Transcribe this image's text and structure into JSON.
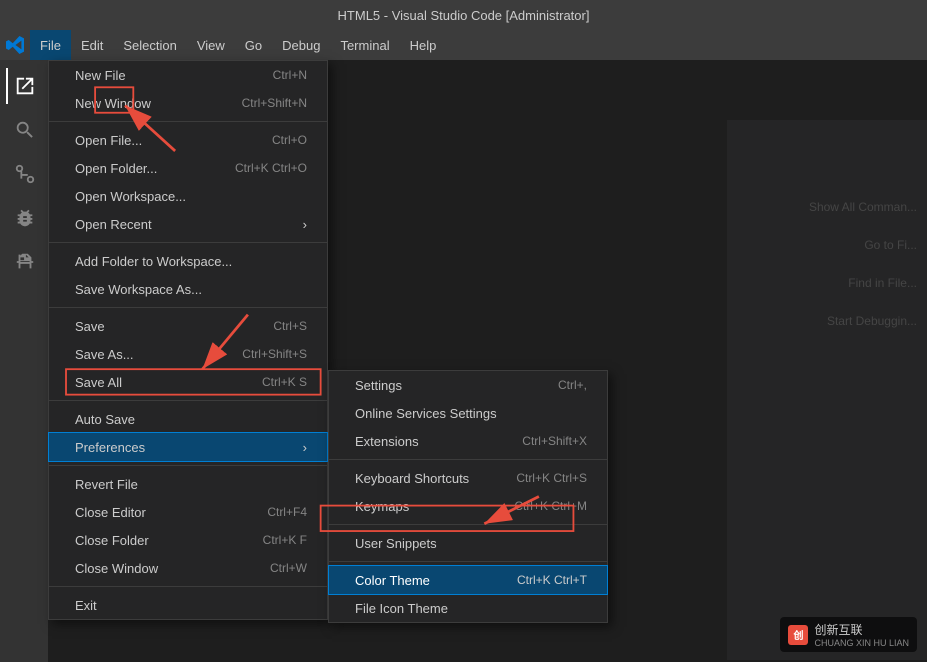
{
  "titleBar": {
    "title": "HTML5 - Visual Studio Code [Administrator]"
  },
  "menuBar": {
    "items": [
      {
        "label": "File",
        "active": true
      },
      {
        "label": "Edit"
      },
      {
        "label": "Selection"
      },
      {
        "label": "View"
      },
      {
        "label": "Go"
      },
      {
        "label": "Debug"
      },
      {
        "label": "Terminal"
      },
      {
        "label": "Help"
      }
    ]
  },
  "fileMenu": {
    "items": [
      {
        "label": "New File",
        "shortcut": "Ctrl+N",
        "separator": false
      },
      {
        "label": "New Window",
        "shortcut": "Ctrl+Shift+N",
        "separator": false
      },
      {
        "label": "",
        "separator": true
      },
      {
        "label": "Open File...",
        "shortcut": "Ctrl+O",
        "separator": false
      },
      {
        "label": "Open Folder...",
        "shortcut": "Ctrl+K Ctrl+O",
        "separator": false
      },
      {
        "label": "Open Workspace...",
        "shortcut": "",
        "separator": false
      },
      {
        "label": "Open Recent",
        "shortcut": "",
        "arrow": true,
        "separator": false
      },
      {
        "label": "",
        "separator": true
      },
      {
        "label": "Add Folder to Workspace...",
        "shortcut": "",
        "separator": false
      },
      {
        "label": "Save Workspace As...",
        "shortcut": "",
        "separator": false
      },
      {
        "label": "",
        "separator": true
      },
      {
        "label": "Save",
        "shortcut": "Ctrl+S",
        "separator": false
      },
      {
        "label": "Save As...",
        "shortcut": "Ctrl+Shift+S",
        "separator": false
      },
      {
        "label": "Save All",
        "shortcut": "Ctrl+K S",
        "separator": false
      },
      {
        "label": "",
        "separator": true
      },
      {
        "label": "Auto Save",
        "shortcut": "",
        "separator": false
      },
      {
        "label": "Preferences",
        "shortcut": "",
        "arrow": true,
        "separator": false,
        "highlighted": true
      },
      {
        "label": "",
        "separator": true
      },
      {
        "label": "Revert File",
        "shortcut": "",
        "separator": false
      },
      {
        "label": "Close Editor",
        "shortcut": "Ctrl+F4",
        "separator": false
      },
      {
        "label": "Close Folder",
        "shortcut": "Ctrl+K F",
        "separator": false
      },
      {
        "label": "Close Window",
        "shortcut": "Ctrl+W",
        "separator": false
      },
      {
        "label": "",
        "separator": true
      },
      {
        "label": "Exit",
        "shortcut": "",
        "separator": false
      }
    ]
  },
  "preferencesMenu": {
    "items": [
      {
        "label": "Settings",
        "shortcut": "Ctrl+,",
        "separator": false
      },
      {
        "label": "Online Services Settings",
        "shortcut": "",
        "separator": false
      },
      {
        "label": "Extensions",
        "shortcut": "Ctrl+Shift+X",
        "separator": false
      },
      {
        "label": "",
        "separator": true
      },
      {
        "label": "Keyboard Shortcuts",
        "shortcut": "Ctrl+K Ctrl+S",
        "separator": false
      },
      {
        "label": "Keymaps",
        "shortcut": "Ctrl+K Ctrl+M",
        "separator": false
      },
      {
        "label": "",
        "separator": true
      },
      {
        "label": "User Snippets",
        "shortcut": "",
        "separator": false
      },
      {
        "label": "",
        "separator": true
      },
      {
        "label": "Color Theme",
        "shortcut": "Ctrl+K Ctrl+T",
        "highlighted": true,
        "separator": false
      },
      {
        "label": "File Icon Theme",
        "shortcut": "",
        "separator": false
      }
    ]
  },
  "rightShortcuts": [
    "Show All Commands",
    "Go to File...",
    "Find in Files",
    "Start Debugging"
  ],
  "activityBar": {
    "icons": [
      "📄",
      "🔍",
      "⑂",
      "🐛",
      "⊞"
    ]
  },
  "watermark": {
    "text": "创新互联",
    "subtext": "CHUANG XIN HU LIAN"
  }
}
